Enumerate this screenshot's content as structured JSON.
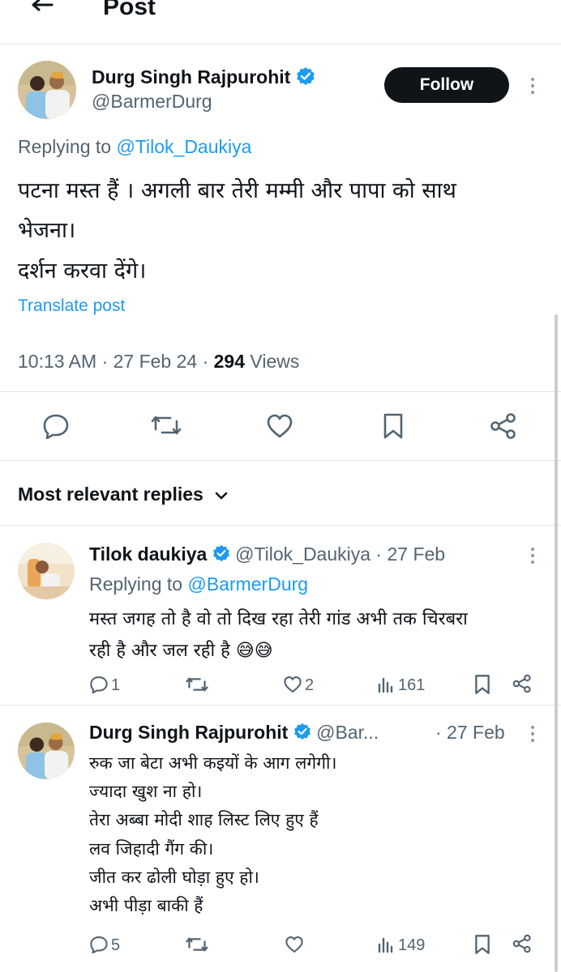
{
  "header": {
    "back_icon": "arrow-left-icon",
    "title": "Post"
  },
  "main_post": {
    "author_name": "Durg Singh Rajpurohit",
    "handle": "@BarmerDurg",
    "follow_label": "Follow",
    "replying_prefix": "Replying to ",
    "replying_to": "@Tilok_Daukiya",
    "text_line1": "पटना मस्त हैं । अगली बार तेरी मम्मी और पापा को साथ",
    "text_line2": "भेजना।",
    "text_line3": "दर्शन करवा देंगे।",
    "translate_label": "Translate post",
    "time": "10:13 AM · 27 Feb 24 · ",
    "views_count": "294",
    "views_label": " Views",
    "actions": [
      "reply-icon",
      "repost-icon",
      "like-icon",
      "bookmark-icon",
      "share-icon"
    ]
  },
  "replies_header": {
    "label": "Most relevant replies"
  },
  "replies": [
    {
      "author_name": "Tilok daukiya",
      "handle_date": "@Tilok_Daukiya · 27 Feb",
      "replying_prefix": "Replying to ",
      "replying_to": "@BarmerDurg",
      "text_line1": "मस्त जगह तो है वो तो दिख रहा तेरी गांड अभी तक चिरबरा",
      "text_line2": "रही है और जल रही है 😅😅",
      "reply_count": "1",
      "like_count": "2",
      "views_count": "161"
    },
    {
      "author_name": "Durg Singh Rajpurohit",
      "handle": "@Bar...",
      "date": "· 27 Feb",
      "lines": [
        "रुक जा बेटा अभी कइयों के आग लगेगी।",
        "ज्यादा खुश ना हो।",
        "तेरा अब्बा मोदी शाह लिस्ट लिए हुए हैं",
        "लव जिहादी गैंग की।",
        "जीत कर ढोली घोड़ा हुए हो।",
        "अभी पीड़ा बाकी हैं"
      ],
      "reply_count": "5",
      "views_count": "149"
    }
  ],
  "colors": {
    "link": "#1d9bf0",
    "verified": "#1d9bf0",
    "text": "#0f1419",
    "muted": "#536471"
  }
}
